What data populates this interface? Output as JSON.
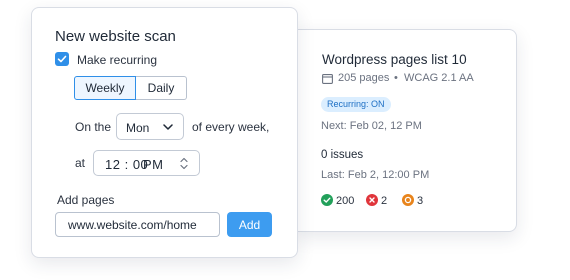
{
  "scan_card": {
    "title": "New website scan",
    "recurring_label": "Make recurring",
    "recurring_checked": true,
    "frequency": {
      "options": [
        "Weekly",
        "Daily"
      ],
      "selected": "Weekly"
    },
    "on_the_label": "On the",
    "day_select_value": "Mon",
    "of_every_week_label": "of every week,",
    "at_label": "at",
    "time": {
      "hour": "12",
      "minute": "00",
      "period": "PM"
    },
    "add_pages_label": "Add pages",
    "url_value": "www.website.com/home",
    "add_button_label": "Add"
  },
  "site_card": {
    "title": "Wordpress pages list 10",
    "pages": "205 pages",
    "separator": "•",
    "standard": "WCAG 2.1 AA",
    "recurring_badge": "Recurring: ON",
    "next_run": "Next: Feb 02, 12 PM",
    "issues": "0 issues",
    "last_run": "Last: Feb 2, 12:00 PM",
    "status_counts": [
      {
        "icon": "check-circle-icon",
        "value": "200",
        "color": "#22a05a"
      },
      {
        "icon": "x-circle-icon",
        "value": "2",
        "color": "#e0353b"
      },
      {
        "icon": "warning-circle-icon",
        "value": "3",
        "color": "#e8841c"
      }
    ]
  },
  "colors": {
    "accent": "#3d9cf0",
    "badge_bg": "#dbeeff",
    "badge_text": "#1d6fc4"
  }
}
